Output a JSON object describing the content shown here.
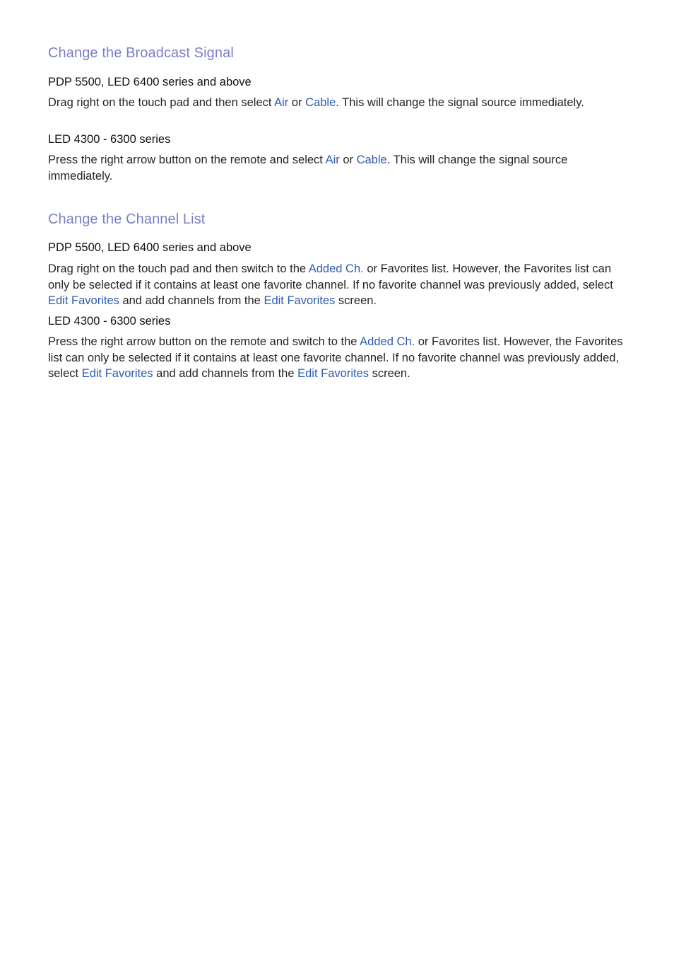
{
  "colors": {
    "heading": "#7b7fc8",
    "link": "#2d5bb0",
    "text": "#252525"
  },
  "sections": [
    {
      "title": "Change the Broadcast Signal",
      "blocks": [
        {
          "subtitle": "PDP 5500, LED 6400 series and above",
          "segments": [
            {
              "text": "Drag right on the touch pad and then select "
            },
            {
              "text": "Air",
              "link": true
            },
            {
              "text": " or "
            },
            {
              "text": "Cable",
              "link": true
            },
            {
              "text": ". This will change the signal source immediately."
            }
          ]
        },
        {
          "subtitle": "LED 4300 - 6300 series",
          "segments": [
            {
              "text": "Press the right arrow button on the remote and select "
            },
            {
              "text": "Air",
              "link": true
            },
            {
              "text": " or "
            },
            {
              "text": "Cable",
              "link": true
            },
            {
              "text": ". This will change the signal source immediately."
            }
          ]
        }
      ]
    },
    {
      "title": "Change the Channel List",
      "blocks": [
        {
          "subtitle": "PDP 5500, LED 6400 series and above",
          "segments": [
            {
              "text": "Drag right on the touch pad and then switch to the "
            },
            {
              "text": "Added Ch.",
              "link": true
            },
            {
              "text": " or Favorites list. However, the Favorites list can only be selected if it contains at least one favorite channel. If no favorite channel was previously added, select "
            },
            {
              "text": "Edit Favorites",
              "link": true
            },
            {
              "text": " and add channels from the "
            },
            {
              "text": "Edit Favorites",
              "link": true
            },
            {
              "text": " screen."
            }
          ]
        },
        {
          "subtitle": "LED 4300 - 6300 series",
          "segments": [
            {
              "text": "Press the right arrow button on the remote and switch to the "
            },
            {
              "text": "Added Ch.",
              "link": true
            },
            {
              "text": " or Favorites list. However, the Favorites list can only be selected if it contains at least one favorite channel. If no favorite channel was previously added, select "
            },
            {
              "text": "Edit Favorites",
              "link": true
            },
            {
              "text": " and add channels from the "
            },
            {
              "text": "Edit Favorites",
              "link": true
            },
            {
              "text": " screen."
            }
          ]
        }
      ]
    }
  ]
}
